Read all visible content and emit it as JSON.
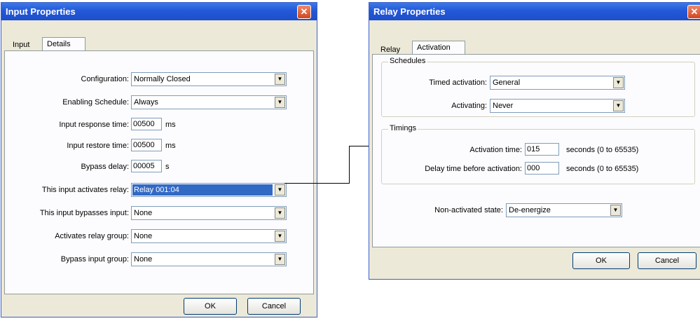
{
  "input_window": {
    "title": "Input Properties",
    "close_glyph": "✕",
    "tabs": [
      "Input",
      "Details"
    ],
    "fields": {
      "configuration": {
        "label": "Configuration:",
        "value": "Normally Closed"
      },
      "enabling_schedule": {
        "label": "Enabling Schedule:",
        "value": "Always"
      },
      "input_response_time": {
        "label": "Input response time:",
        "value": "00500",
        "unit": "ms"
      },
      "input_restore_time": {
        "label": "Input restore time:",
        "value": "00500",
        "unit": "ms"
      },
      "bypass_delay": {
        "label": "Bypass delay:",
        "value": "00005",
        "unit": "s"
      },
      "activates_relay": {
        "label": "This input activates relay:",
        "value": "Relay 001:04"
      },
      "bypasses_input": {
        "label": "This input bypasses input:",
        "value": "None"
      },
      "activates_relay_group": {
        "label": "Activates relay group:",
        "value": "None"
      },
      "bypass_input_group": {
        "label": "Bypass input group:",
        "value": "None"
      }
    },
    "ok_label": "OK",
    "cancel_label": "Cancel"
  },
  "relay_window": {
    "title": "Relay Properties",
    "close_glyph": "✕",
    "tabs": [
      "Relay",
      "Activation"
    ],
    "schedules_group": "Schedules",
    "timings_group": "Timings",
    "fields": {
      "timed_activation": {
        "label": "Timed activation:",
        "value": "General"
      },
      "activating": {
        "label": "Activating:",
        "value": "Never"
      },
      "activation_time": {
        "label": "Activation time:",
        "value": "015",
        "suffix": "seconds (0 to 65535)"
      },
      "delay_time": {
        "label": "Delay time before activation:",
        "value": "000",
        "suffix": "seconds (0 to 65535)"
      },
      "non_activated_state": {
        "label": "Non-activated state:",
        "value": "De-energize"
      }
    },
    "ok_label": "OK",
    "cancel_label": "Cancel"
  },
  "icons": {
    "dropdown_arrow": "▼"
  }
}
